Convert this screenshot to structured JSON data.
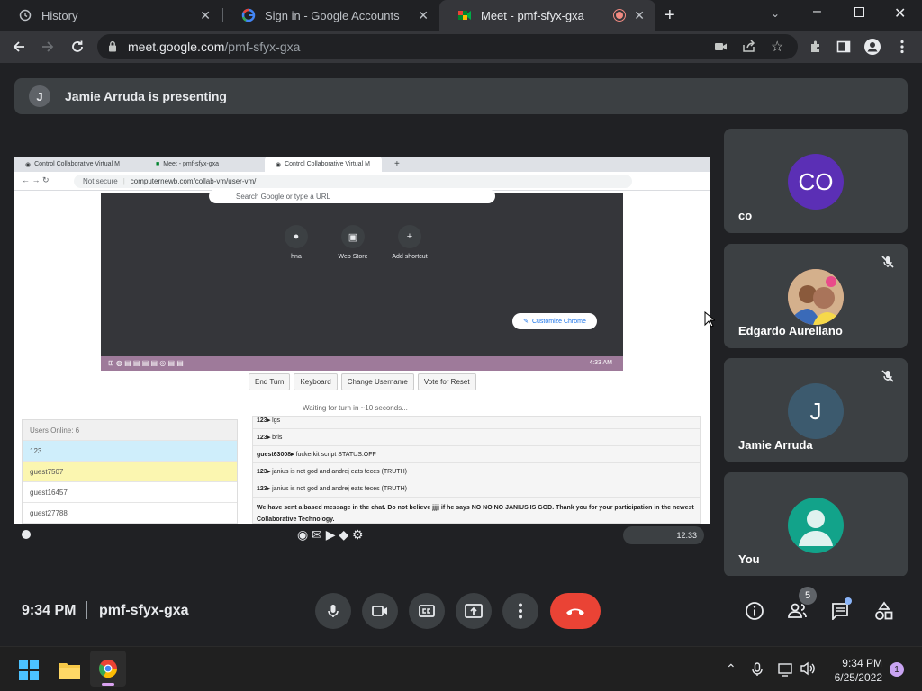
{
  "browser": {
    "tabs": [
      {
        "title": "History",
        "icon": "history-icon"
      },
      {
        "title": "Sign in - Google Accounts",
        "icon": "google-icon"
      },
      {
        "title": "Meet - pmf-sfyx-gxa",
        "icon": "meet-icon",
        "active": true
      }
    ],
    "url_host": "meet.google.com",
    "url_path": "/pmf-sfyx-gxa"
  },
  "meet": {
    "presenting_initial": "J",
    "presenting_text": "Jamie Arruda is presenting",
    "time": "9:34 PM",
    "meeting_code": "pmf-sfyx-gxa",
    "people_count": "5",
    "participants": [
      {
        "name": "co",
        "initials": "CO",
        "color": "#5b2fb5",
        "muted": false
      },
      {
        "name": "Edgardo Aurellano",
        "initials": "",
        "muted": true
      },
      {
        "name": "Jamie Arruda",
        "initials": "J",
        "color": "#3c5a6e",
        "muted": true
      },
      {
        "name": "You",
        "initials": "",
        "color": "#12a38a",
        "muted": false
      }
    ]
  },
  "shared_screen": {
    "tabs": [
      "Control Collaborative Virtual M",
      "Meet - pmf-sfyx-gxa",
      "Control Collaborative Virtual M"
    ],
    "not_secure": "Not secure",
    "url": "computernewb.com/collab-vm/user-vm/",
    "search_placeholder": "Search Google or type a URL",
    "shortcuts": [
      "hna",
      "Web Store",
      "Add shortcut"
    ],
    "customize": "Customize Chrome",
    "vm_clock": "4:33 AM",
    "buttons": [
      "End Turn",
      "Keyboard",
      "Change Username",
      "Vote for Reset"
    ],
    "waiting": "Waiting for turn in ~10 seconds...",
    "users_header": "Users Online: 6",
    "users": [
      "123",
      "guest7507",
      "guest16457",
      "guest27788"
    ],
    "chat": [
      {
        "user": "123",
        "msg": "lgs"
      },
      {
        "user": "123",
        "msg": "bris"
      },
      {
        "user": "guest63008",
        "msg": "fuckerkit script STATUS:OFF"
      },
      {
        "user": "123",
        "msg": "janius is not god and andrej eats feces (TRUTH)"
      },
      {
        "user": "123",
        "msg": "janius is not god and andrej eats feces (TRUTH)"
      },
      {
        "user": "",
        "msg": "We have sent a based message in the chat. Do not believe jjjj if he says NO NO NO JANIUS IS GOD. Thank you for your participation in the newest Collaborative Technology."
      }
    ],
    "shelf_clock": "12:33"
  },
  "os": {
    "time": "9:34 PM",
    "date": "6/25/2022",
    "notification_count": "1"
  },
  "colors": {
    "end_call": "#ea4335",
    "accent_blue": "#8ab4f8"
  }
}
